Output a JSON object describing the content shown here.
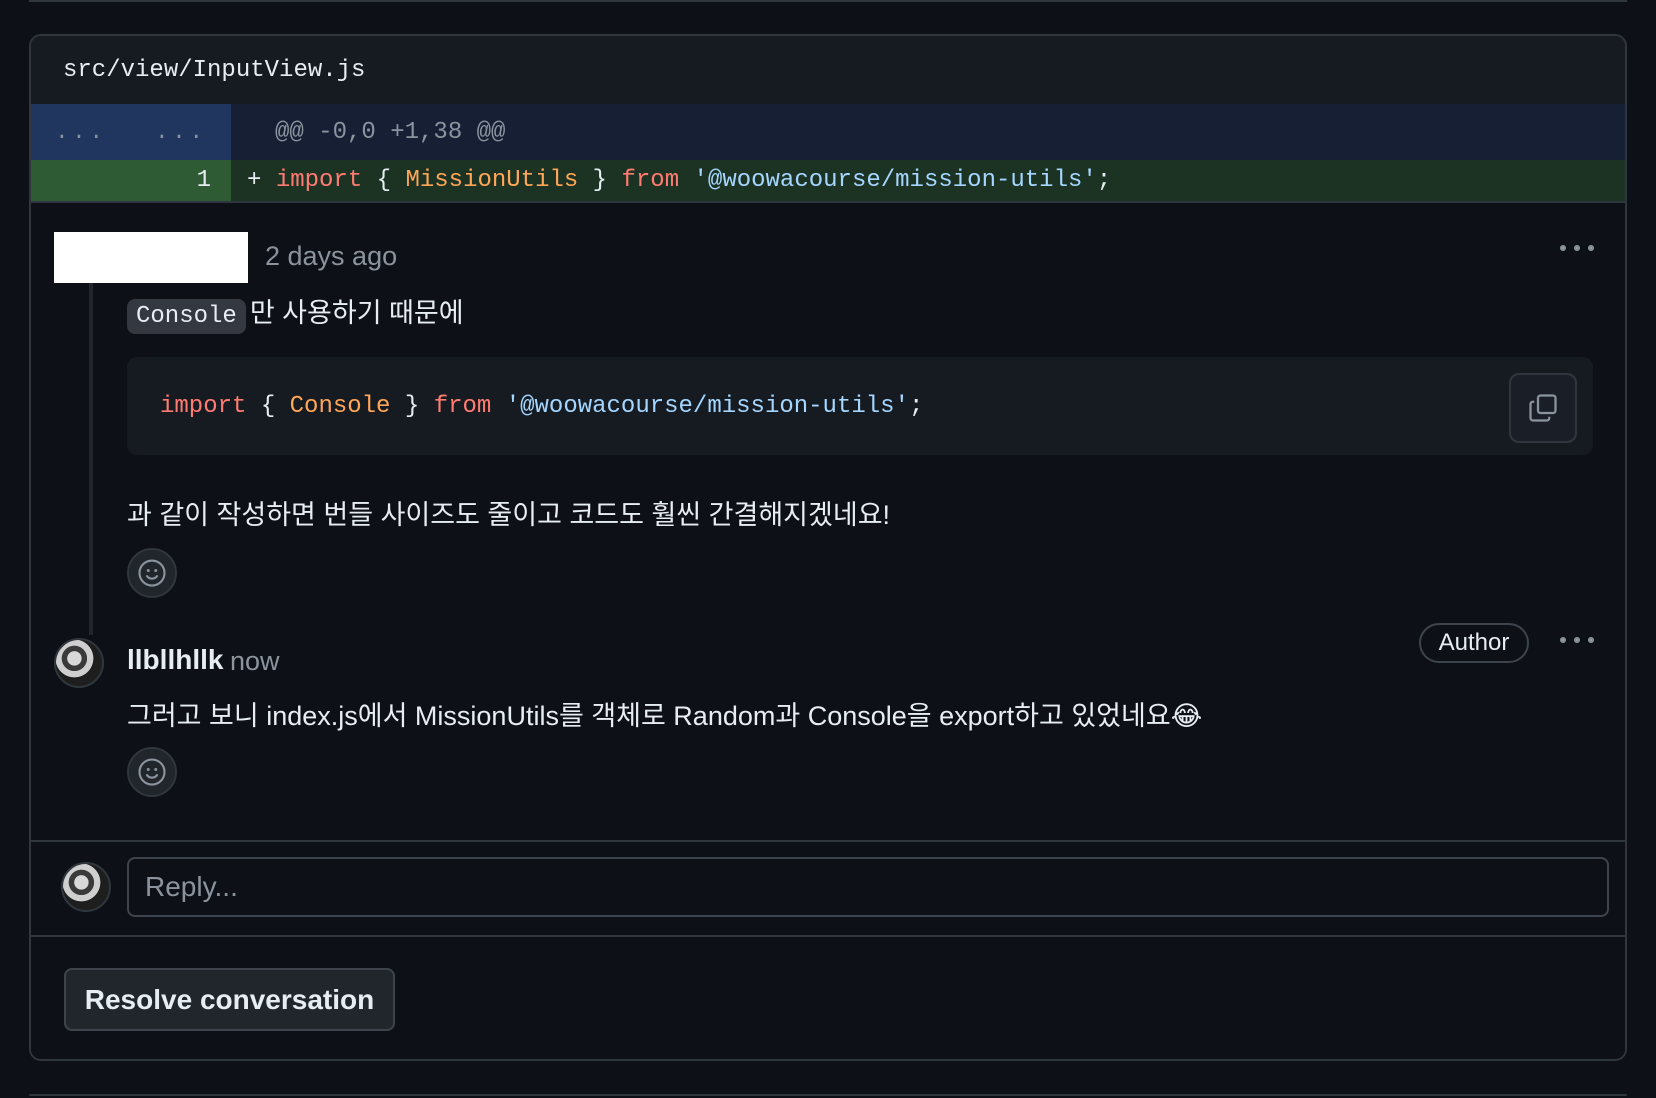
{
  "file": {
    "path": "src/view/InputView.js"
  },
  "diff": {
    "hunk": {
      "old_gutter": "...",
      "new_gutter": "...",
      "header": "@@ -0,0 +1,38 @@"
    },
    "added_line": {
      "line_number": "1",
      "sign": "+",
      "tokens": [
        {
          "text": "import",
          "kind": "kw"
        },
        {
          "text": " { ",
          "kind": "plain"
        },
        {
          "text": "MissionUtils",
          "kind": "cls"
        },
        {
          "text": " } ",
          "kind": "plain"
        },
        {
          "text": "from",
          "kind": "kw"
        },
        {
          "text": " ",
          "kind": "plain"
        },
        {
          "text": "'@woowacourse/mission-utils'",
          "kind": "str"
        },
        {
          "text": ";",
          "kind": "plain"
        }
      ]
    }
  },
  "comment1": {
    "time": "2 days ago",
    "inline_code": "Console",
    "text_before_code": "만 사용하기 때문에",
    "code_tokens": [
      {
        "text": "import",
        "kind": "kw"
      },
      {
        "text": " { ",
        "kind": "plain"
      },
      {
        "text": "Console",
        "kind": "cls"
      },
      {
        "text": " } ",
        "kind": "plain"
      },
      {
        "text": "from",
        "kind": "kw"
      },
      {
        "text": " ",
        "kind": "plain"
      },
      {
        "text": "'@woowacourse/mission-utils'",
        "kind": "str"
      },
      {
        "text": ";",
        "kind": "plain"
      }
    ],
    "text_after_code": "과 같이 작성하면 번들 사이즈도 줄이고 코드도 훨씬 간결해지겠네요!"
  },
  "comment2": {
    "author": "llbllhllk",
    "time": "now",
    "badge": "Author",
    "text": "그러고 보니 index.js에서 MissionUtils를 객체로 Random과 Console을 export하고 있었네요😂"
  },
  "reply": {
    "placeholder": "Reply..."
  },
  "resolve": {
    "label": "Resolve conversation"
  },
  "colors": {
    "keyword": "#ff7b72",
    "class": "#ffa657",
    "string": "#a5d6ff",
    "added_bg": "#1c3324",
    "hunk_bg": "#161f34"
  }
}
